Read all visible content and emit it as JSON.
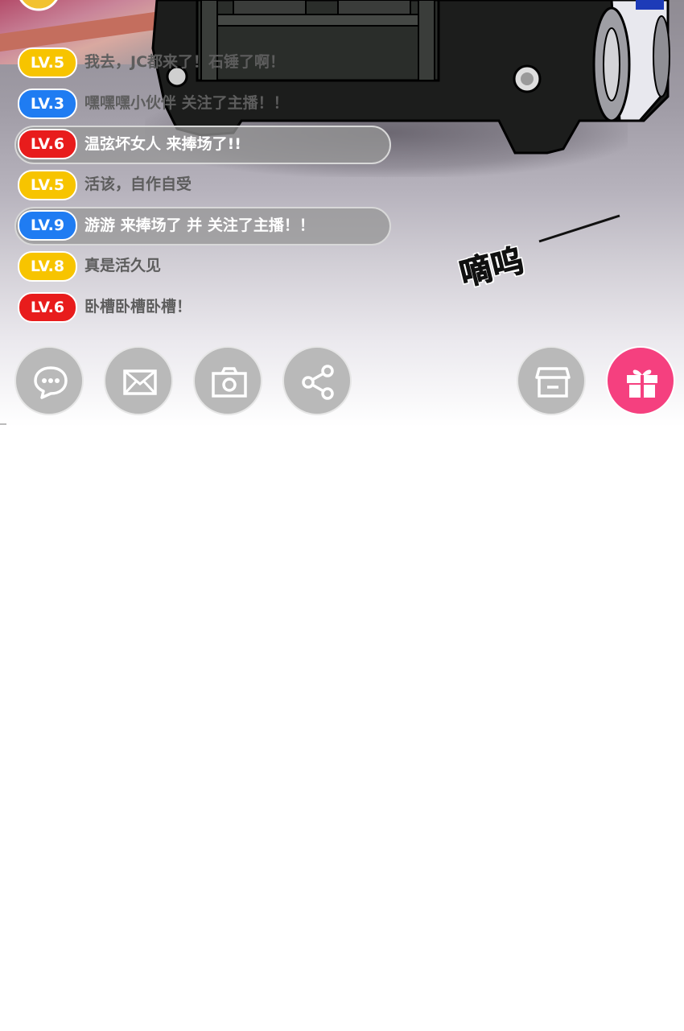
{
  "scene": {
    "sound_effect": "嘀呜"
  },
  "chat": {
    "messages": [
      {
        "level": "LV.5",
        "level_color": "#f7c400",
        "text": "我去，JC都来了！石锤了啊！",
        "highlighted": false
      },
      {
        "level": "LV.3",
        "level_color": "#1f7cf2",
        "text": "嘿嘿嘿小伙伴 关注了主播！！",
        "highlighted": false
      },
      {
        "level": "LV.6",
        "level_color": "#e81c1c",
        "text": "温弦坏女人 来捧场了!!",
        "highlighted": true
      },
      {
        "level": "LV.5",
        "level_color": "#f7c400",
        "text": "活该，自作自受",
        "highlighted": false
      },
      {
        "level": "LV.9",
        "level_color": "#1f7cf2",
        "text": "游游 来捧场了 并 关注了主播！！",
        "highlighted": true
      },
      {
        "level": "LV.8",
        "level_color": "#f7c400",
        "text": "真是活久见",
        "highlighted": false
      },
      {
        "level": "LV.6",
        "level_color": "#e81c1c",
        "text": "卧槽卧槽卧槽！",
        "highlighted": false
      }
    ]
  },
  "toolbar": {
    "buttons": [
      {
        "name": "comment",
        "icon": "chat-bubble-icon"
      },
      {
        "name": "message",
        "icon": "envelope-icon"
      },
      {
        "name": "camera",
        "icon": "camera-icon"
      },
      {
        "name": "share",
        "icon": "share-icon"
      },
      {
        "name": "shop",
        "icon": "store-icon"
      },
      {
        "name": "gift",
        "icon": "gift-icon",
        "color": "#f5407f"
      }
    ]
  }
}
